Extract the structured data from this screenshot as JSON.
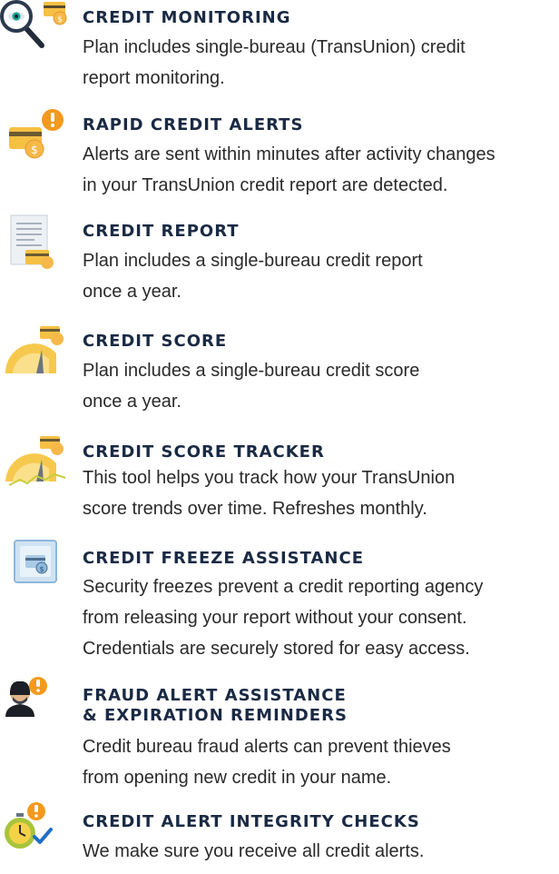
{
  "colors": {
    "title": "#1a2a44",
    "text": "#2a2a2a",
    "card_gold": "#f5c044",
    "coin": "#f7b84a",
    "alert_orange": "#f39a1e",
    "gauge": "#f6c94e",
    "check_blue": "#1e6fc5",
    "vault_blue": "#8bb8dd"
  },
  "features": [
    {
      "icon": "magnifier-card-icon",
      "title": "CREDIT MONITORING",
      "lines": [
        "Plan includes single-bureau (TransUnion) credit",
        "report monitoring."
      ]
    },
    {
      "icon": "card-alert-icon",
      "title": "RAPID CREDIT ALERTS",
      "lines": [
        "Alerts are sent within minutes after activity changes",
        "in your TransUnion credit report are detected."
      ]
    },
    {
      "icon": "report-document-icon",
      "title": "CREDIT REPORT",
      "lines": [
        "Plan includes a single-bureau credit report",
        "once a year."
      ]
    },
    {
      "icon": "score-gauge-icon",
      "title": "CREDIT SCORE",
      "lines": [
        "Plan includes a single-bureau credit score",
        "once a year."
      ]
    },
    {
      "icon": "score-tracker-icon",
      "title": "CREDIT SCORE TRACKER",
      "lines": [
        "This tool helps you track how your TransUnion",
        "score trends over time. Refreshes monthly."
      ]
    },
    {
      "icon": "freeze-vault-icon",
      "title": "CREDIT FREEZE ASSISTANCE",
      "lines": [
        "Security freezes prevent a credit reporting agency",
        "from releasing your report without your consent.",
        "Credentials are securely stored for easy access."
      ]
    },
    {
      "icon": "fraud-thief-icon",
      "title_lines": [
        "FRAUD ALERT ASSISTANCE",
        "& EXPIRATION REMINDERS"
      ],
      "lines": [
        "Credit bureau fraud alerts can prevent thieves",
        "from opening new credit in your name."
      ]
    },
    {
      "icon": "stopwatch-check-icon",
      "title": "CREDIT ALERT INTEGRITY CHECKS",
      "lines": [
        "We make sure you receive all credit alerts."
      ]
    }
  ]
}
